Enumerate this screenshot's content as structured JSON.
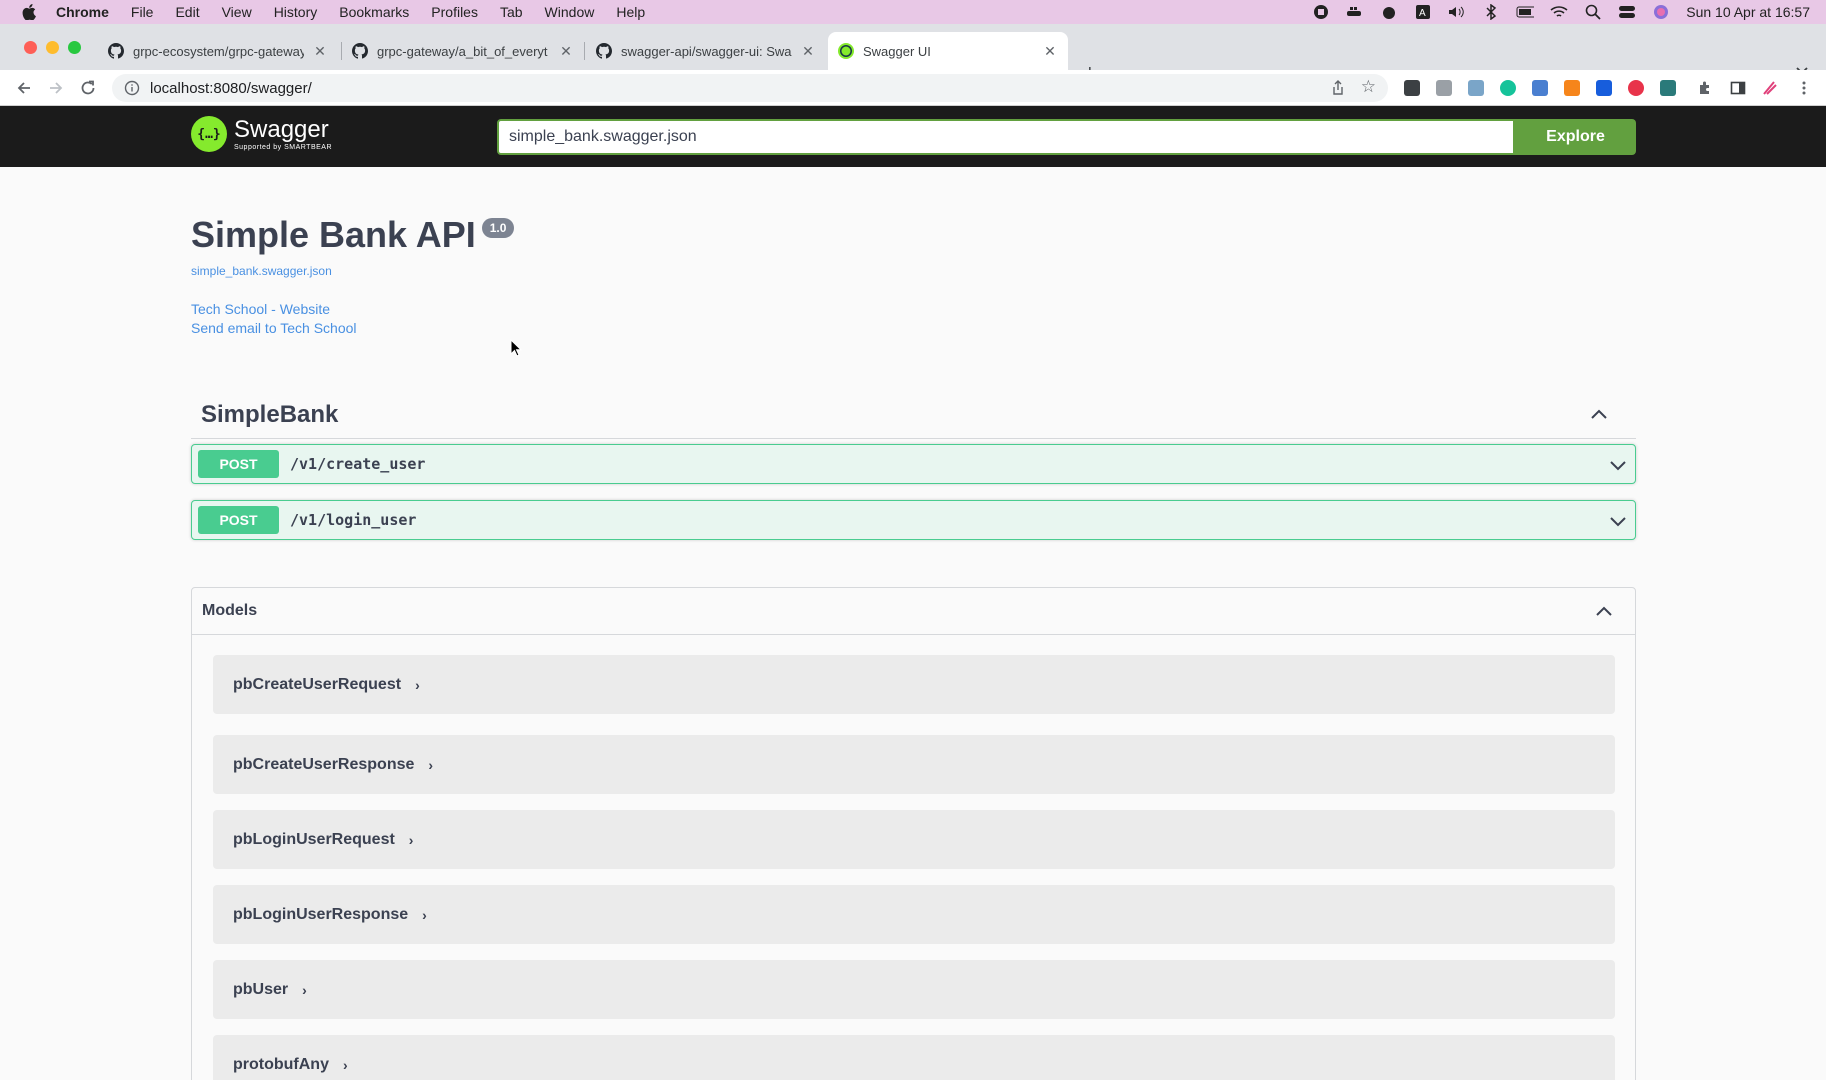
{
  "menubar": {
    "app": "Chrome",
    "items": [
      "File",
      "Edit",
      "View",
      "History",
      "Bookmarks",
      "Profiles",
      "Tab",
      "Window",
      "Help"
    ],
    "clock": "Sun 10 Apr at  16:57"
  },
  "tabs": [
    {
      "title": "grpc-ecosystem/grpc-gateway",
      "icon": "github-icon"
    },
    {
      "title": "grpc-gateway/a_bit_of_everyt",
      "icon": "github-icon"
    },
    {
      "title": "swagger-api/swagger-ui: Swag",
      "icon": "github-icon"
    },
    {
      "title": "Swagger UI",
      "icon": "swagger-icon",
      "active": true
    }
  ],
  "address_bar": {
    "url": "localhost:8080/swagger/"
  },
  "swagger": {
    "logo_name": "Swagger",
    "logo_sub": "Supported by SMARTBEAR",
    "url_input": "simple_bank.swagger.json",
    "explore_label": "Explore"
  },
  "info": {
    "title": "Simple Bank API",
    "version": "1.0",
    "spec_link": "simple_bank.swagger.json",
    "contact_website": "Tech School - Website",
    "contact_email": "Send email to Tech School"
  },
  "tag": {
    "name": "SimpleBank",
    "operations": [
      {
        "method": "POST",
        "path": "/v1/create_user"
      },
      {
        "method": "POST",
        "path": "/v1/login_user"
      }
    ]
  },
  "models": {
    "title": "Models",
    "items": [
      "pbCreateUserRequest",
      "pbCreateUserResponse",
      "pbLoginUserRequest",
      "pbLoginUserResponse",
      "pbUser",
      "protobufAny"
    ]
  },
  "colors": {
    "post": "#49cc90",
    "swagger_green": "#62a03f",
    "link": "#4990e2"
  }
}
